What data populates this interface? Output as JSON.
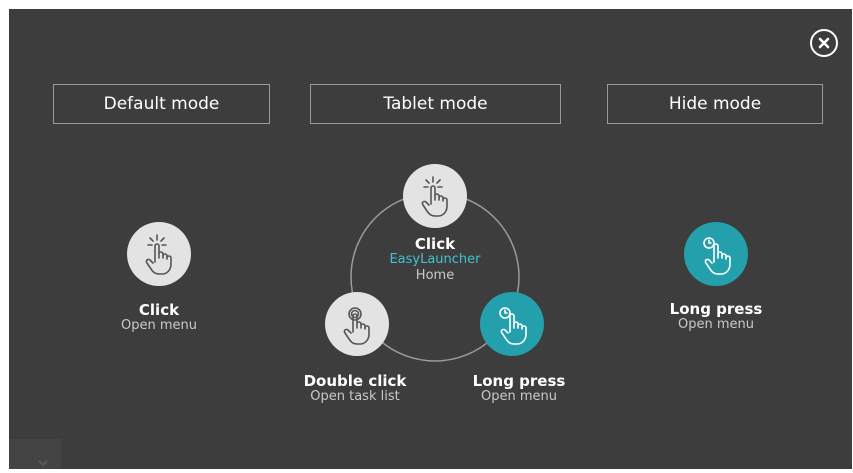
{
  "dialog": {
    "close_icon": "close-circle-icon"
  },
  "modes": [
    {
      "label": "Default mode"
    },
    {
      "label": "Tablet mode"
    },
    {
      "label": "Hide mode"
    }
  ],
  "default_mode": {
    "click": {
      "title": "Click",
      "action": "Open menu",
      "icon": "tap-icon"
    }
  },
  "tablet_mode": {
    "click": {
      "title": "Click",
      "target": "EasyLauncher",
      "action": "Home",
      "icon": "tap-icon"
    },
    "double_click": {
      "title": "Double click",
      "action": "Open task list",
      "icon": "double-tap-icon"
    },
    "long_press": {
      "title": "Long press",
      "action": "Open menu",
      "icon": "long-press-icon"
    }
  },
  "hide_mode": {
    "long_press": {
      "title": "Long press",
      "action": "Open menu",
      "icon": "long-press-icon"
    }
  },
  "colors": {
    "panel": "#3d3d3d",
    "accent": "#23a0ac",
    "accent_text": "#3fc3d2",
    "light_circle": "#e3e3e3"
  }
}
